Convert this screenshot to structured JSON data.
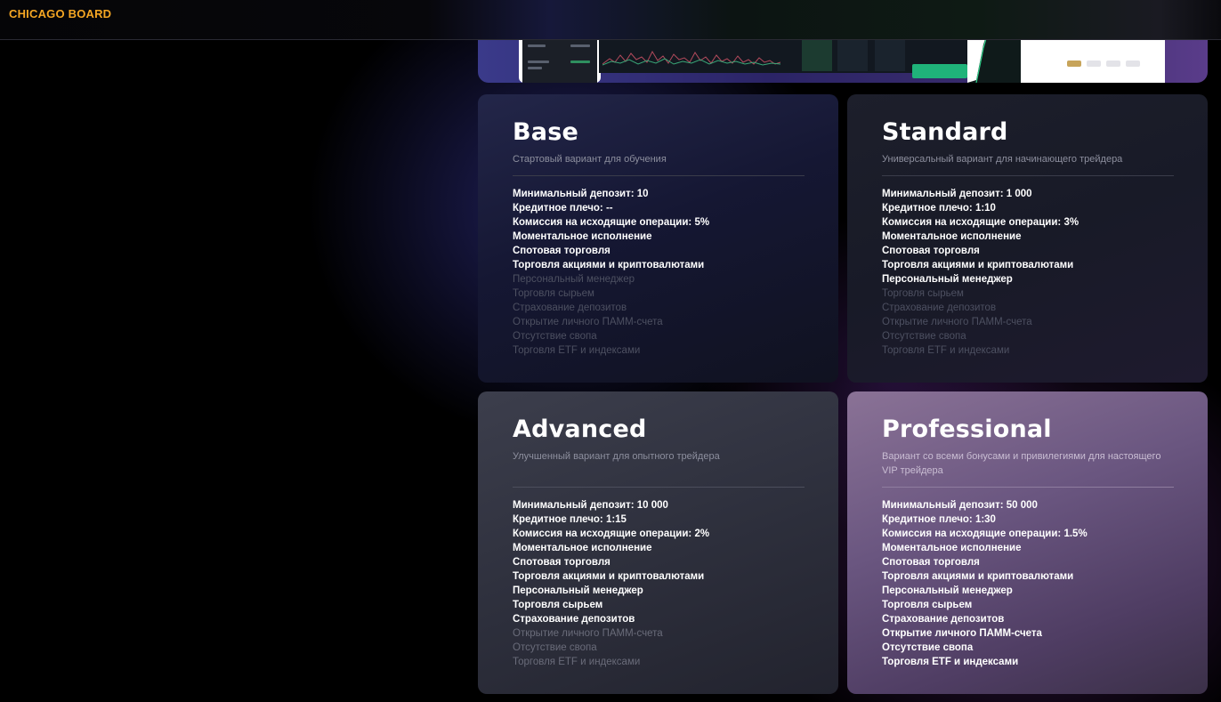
{
  "header": {
    "brand": "CHICAGO BOARD"
  },
  "plans": [
    {
      "name": "Base",
      "subtitle": "Стартовый вариант для обучения",
      "features": [
        {
          "text": "Минимальный депозит: 10",
          "included": true
        },
        {
          "text": "Кредитное плечо: --",
          "included": true
        },
        {
          "text": "Комиссия на исходящие операции: 5%",
          "included": true
        },
        {
          "text": "Моментальное исполнение",
          "included": true
        },
        {
          "text": "Спотовая торговля",
          "included": true
        },
        {
          "text": "Торговля акциями и криптовалютами",
          "included": true
        },
        {
          "text": "Персональный менеджер",
          "included": false
        },
        {
          "text": "Торговля сырьем",
          "included": false
        },
        {
          "text": "Страхование депозитов",
          "included": false
        },
        {
          "text": "Открытие личного ПАММ-счета",
          "included": false
        },
        {
          "text": "Отсутствие свопа",
          "included": false
        },
        {
          "text": "Торговля ETF и индексами",
          "included": false
        }
      ]
    },
    {
      "name": "Standard",
      "subtitle": "Универсальный вариант для начинающего трейдера",
      "features": [
        {
          "text": "Минимальный депозит: 1 000",
          "included": true
        },
        {
          "text": "Кредитное плечо: 1:10",
          "included": true
        },
        {
          "text": "Комиссия на исходящие операции: 3%",
          "included": true
        },
        {
          "text": "Моментальное исполнение",
          "included": true
        },
        {
          "text": "Спотовая торговля",
          "included": true
        },
        {
          "text": "Торговля акциями и криптовалютами",
          "included": true
        },
        {
          "text": "Персональный менеджер",
          "included": true
        },
        {
          "text": "Торговля сырьем",
          "included": false
        },
        {
          "text": "Страхование депозитов",
          "included": false
        },
        {
          "text": "Открытие личного ПАММ-счета",
          "included": false
        },
        {
          "text": "Отсутствие свопа",
          "included": false
        },
        {
          "text": "Торговля ETF и индексами",
          "included": false
        }
      ]
    },
    {
      "name": "Advanced",
      "subtitle": "Улучшенный вариант для опытного трейдера",
      "features": [
        {
          "text": "Минимальный депозит: 10 000",
          "included": true
        },
        {
          "text": "Кредитное плечо: 1:15",
          "included": true
        },
        {
          "text": "Комиссия на исходящие операции: 2%",
          "included": true
        },
        {
          "text": "Моментальное исполнение",
          "included": true
        },
        {
          "text": "Спотовая торговля",
          "included": true
        },
        {
          "text": "Торговля акциями и криптовалютами",
          "included": true
        },
        {
          "text": "Персональный менеджер",
          "included": true
        },
        {
          "text": "Торговля сырьем",
          "included": true
        },
        {
          "text": "Страхование депозитов",
          "included": true
        },
        {
          "text": "Открытие личного ПАММ-счета",
          "included": false
        },
        {
          "text": "Отсутствие свопа",
          "included": false
        },
        {
          "text": "Торговля ETF и индексами",
          "included": false
        }
      ]
    },
    {
      "name": "Professional",
      "subtitle": "Вариант со всеми бонусами и привилегиями для настоящего VIP трейдера",
      "features": [
        {
          "text": "Минимальный депозит: 50 000",
          "included": true
        },
        {
          "text": "Кредитное плечо: 1:30",
          "included": true
        },
        {
          "text": "Комиссия на исходящие операции: 1.5%",
          "included": true
        },
        {
          "text": "Моментальное исполнение",
          "included": true
        },
        {
          "text": "Спотовая торговля",
          "included": true
        },
        {
          "text": "Торговля акциями и криптовалютами",
          "included": true
        },
        {
          "text": "Персональный менеджер",
          "included": true
        },
        {
          "text": "Торговля сырьем",
          "included": true
        },
        {
          "text": "Страхование депозитов",
          "included": true
        },
        {
          "text": "Открытие личного ПАММ-счета",
          "included": true
        },
        {
          "text": "Отсутствие свопа",
          "included": true
        },
        {
          "text": "Торговля ETF и индексами",
          "included": true
        }
      ]
    }
  ]
}
